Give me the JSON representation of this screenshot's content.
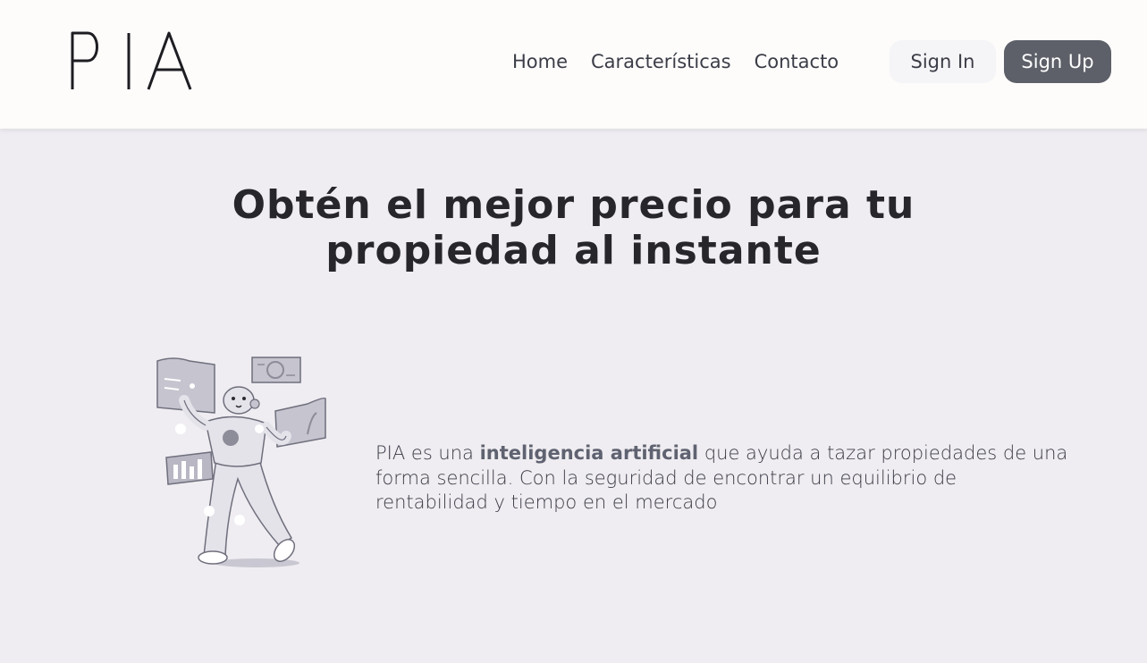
{
  "header": {
    "logo_text": "PIA",
    "nav": [
      {
        "label": "Home"
      },
      {
        "label": "Características"
      },
      {
        "label": "Contacto"
      }
    ],
    "sign_in_label": "Sign In",
    "sign_up_label": "Sign Up"
  },
  "hero": {
    "title_line1": "Obtén el mejor precio para tu",
    "title_line2": "propiedad al instante",
    "description_start": "PIA es una ",
    "description_highlight": "inteligencia artificial",
    "description_end": " que ayuda a tazar propiedades de una forma sencilla. Con la seguridad de encontrar un equilibrio de rentabilidad y tiempo en el mercado"
  },
  "colors": {
    "header_bg": "#fdfcfb",
    "page_bg": "#efedf1",
    "primary_button": "#5d6068",
    "secondary_button": "#f5f4f6",
    "text_dark": "#27262b"
  },
  "icons": [
    "pia-logo",
    "robot-illustration"
  ]
}
